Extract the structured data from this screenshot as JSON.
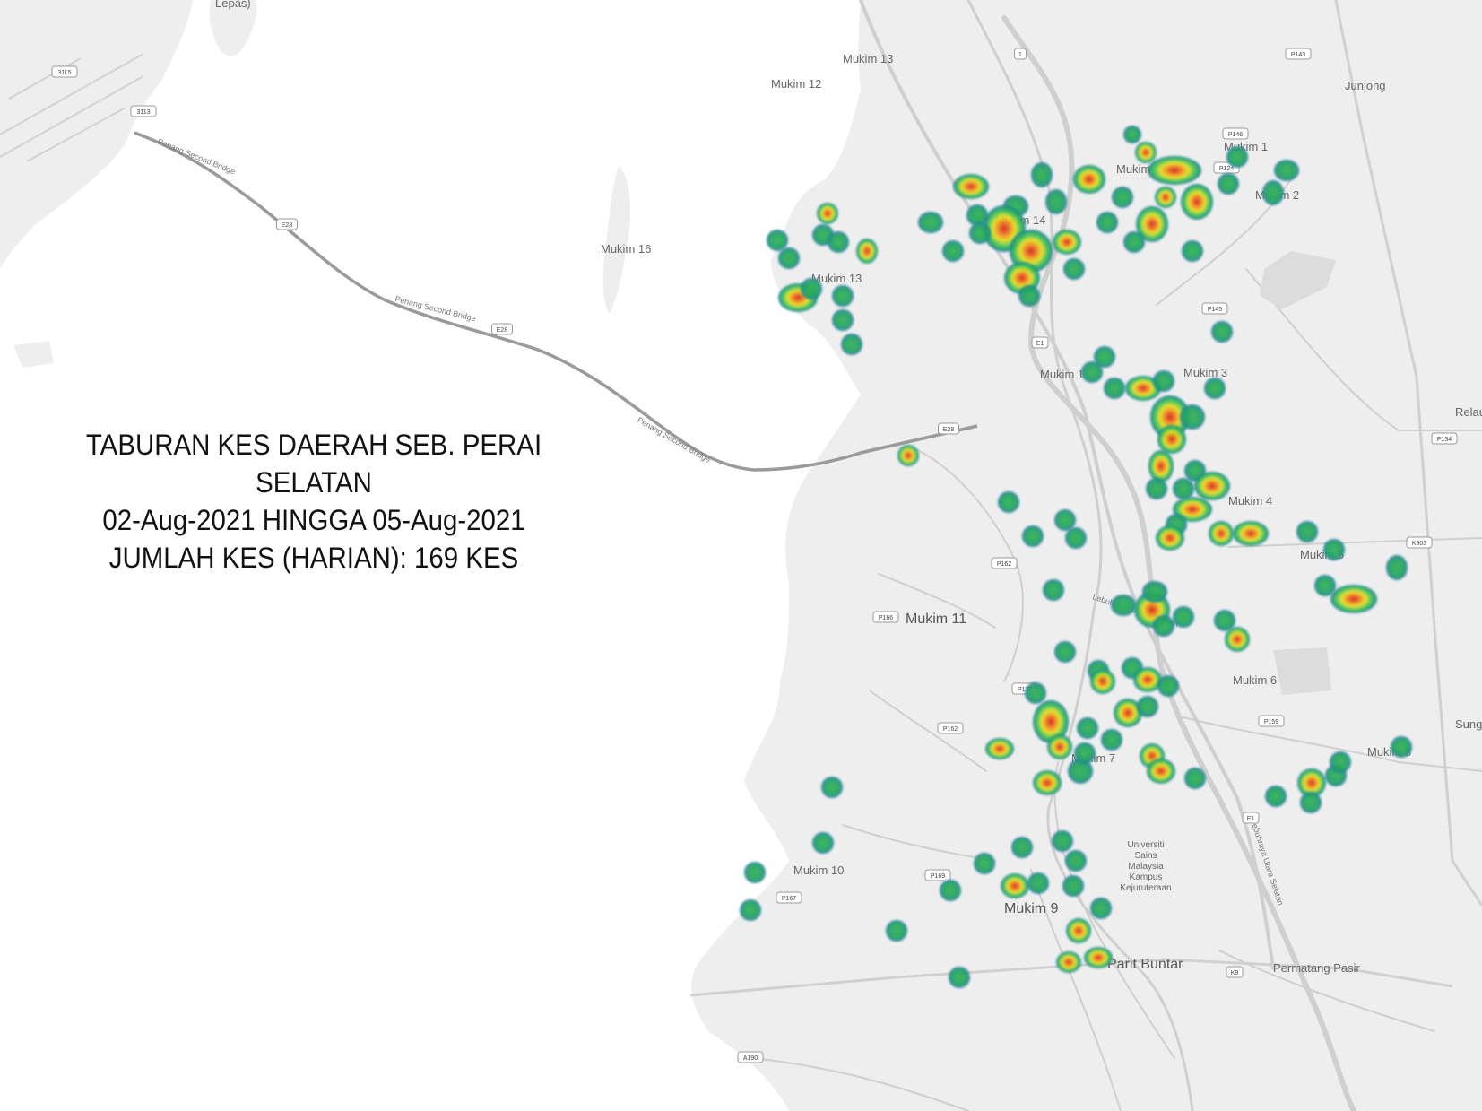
{
  "title": {
    "line1": "TABURAN KES DAERAH SEB. PERAI",
    "line2": "SELATAN",
    "line3": "02-Aug-2021 HINGGA 05-Aug-2021",
    "line4": "JUMLAH KES (HARIAN): 169 KES"
  },
  "colors": {
    "land": "#eeeeee",
    "water": "#ffffff",
    "road": "#c8c8c8",
    "heat_low": "#1f9e6a",
    "heat_mid": "#e6e21a",
    "heat_high": "#d7191c"
  },
  "place_labels": [
    {
      "key": "mukim13a",
      "text": "Mukim 13"
    },
    {
      "key": "mukim12",
      "text": "Mukim 12"
    },
    {
      "key": "mukim16",
      "text": "Mukim 16"
    },
    {
      "key": "mukim13b",
      "text": "Mukim 13"
    },
    {
      "key": "mukim14",
      "text": "Mukim 14"
    },
    {
      "key": "mukim1",
      "text": "Mukim 1"
    },
    {
      "key": "mukim2",
      "text": "Mukim 2"
    },
    {
      "key": "mukimtop",
      "text": "Mukim"
    },
    {
      "key": "junjong",
      "text": "Junjong"
    },
    {
      "key": "mukim3",
      "text": "Mukim 3"
    },
    {
      "key": "mukim1x",
      "text": "Mukim 1"
    },
    {
      "key": "mukim4",
      "text": "Mukim 4"
    },
    {
      "key": "mukim5",
      "text": "Mukim 5"
    },
    {
      "key": "mukim11",
      "text": "Mukim 11"
    },
    {
      "key": "mukim6",
      "text": "Mukim 6"
    },
    {
      "key": "mukim7",
      "text": "Mukim 7"
    },
    {
      "key": "mukim8",
      "text": "Mukim 8"
    },
    {
      "key": "mukim10",
      "text": "Mukim 10"
    },
    {
      "key": "mukim9",
      "text": "Mukim 9"
    },
    {
      "key": "paritbuntar",
      "text": "Parit Buntar"
    },
    {
      "key": "permatang",
      "text": "Permatang Pasir"
    },
    {
      "key": "relau",
      "text": "Relau"
    },
    {
      "key": "sung",
      "text": "Sung"
    },
    {
      "key": "lepas",
      "text": "Lepas)"
    },
    {
      "key": "usm",
      "text": "Universiti Sains Malaysia Kampus Kejuruteraan"
    }
  ],
  "road_shields": [
    "3113",
    "3115",
    "E28",
    "E28",
    "E28",
    "E1",
    "P166",
    "P162",
    "P162",
    "P169",
    "P167",
    "P145",
    "P146",
    "P124",
    "P134",
    "K903",
    "P159",
    "K9",
    "A190",
    "1",
    "E1",
    "P177",
    "P143"
  ],
  "bridge_label": "Penang Second Bridge",
  "highway_label": "Lebuhraya Utara Selatan"
}
